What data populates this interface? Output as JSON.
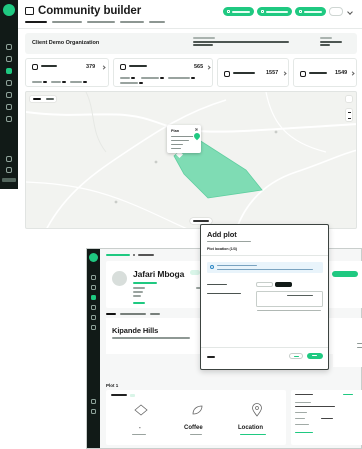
{
  "top_app": {
    "page_title": "Community builder",
    "organization_title": "Client Demo Organization",
    "stats": {
      "members_value": "379",
      "locations_value": "565",
      "transactions_value": "1557",
      "payments_value": "1549"
    },
    "map_popup_title": "Plan"
  },
  "back_window": {
    "farmer_name": "Jafari Mboga",
    "plot_title": "Kipande Hills",
    "plot_section": "Plot 1",
    "highlights": {
      "crop_value": "Coffee",
      "location_value": "Location"
    }
  },
  "modal": {
    "title": "Add plot",
    "step_label": "Plot location (1/3)"
  },
  "colors": {
    "brand_green": "#1fc981",
    "polygon_fill": "#7fdcb4",
    "sidebar_dark": "#111a17",
    "info_blue": "#2a86c4"
  }
}
